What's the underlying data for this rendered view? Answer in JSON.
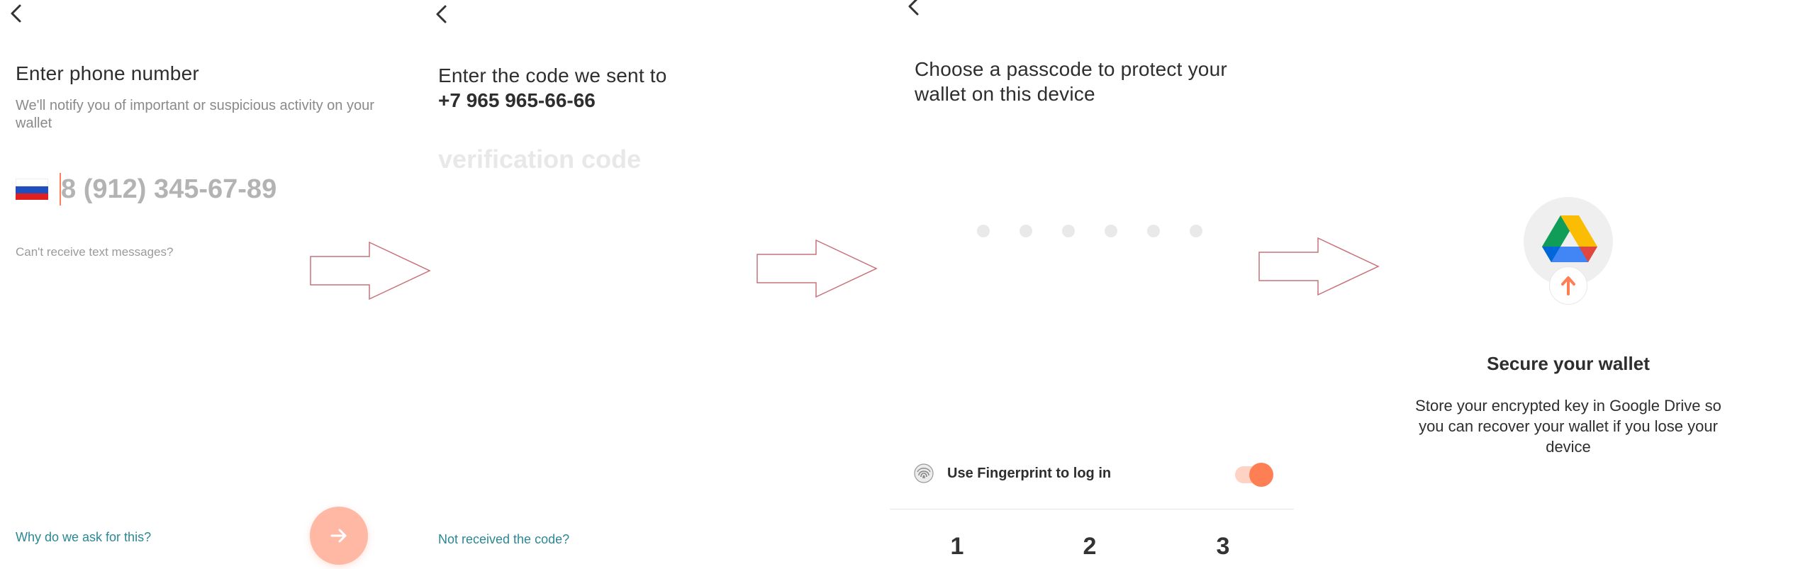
{
  "phone_screen": {
    "title": "Enter phone number",
    "subtitle": "We'll notify you of important or suspicious activity on your wallet",
    "phone_placeholder": "8 (912) 345-67-89",
    "cant_receive": "Can't receive text messages?",
    "why_link": "Why do we ask for this?"
  },
  "code_screen": {
    "title": "Enter the code we sent to",
    "phone": "+7 965 965-66-66",
    "code_placeholder": "verification code",
    "not_received": "Not received the code?"
  },
  "passcode_screen": {
    "title": "Choose a passcode to protect your wallet on this device",
    "dots_count": 6,
    "fingerprint_label": "Use Fingerprint to log in",
    "fingerprint_enabled": true,
    "keys": [
      "1",
      "2",
      "3"
    ]
  },
  "backup_screen": {
    "title": "Secure your wallet",
    "description": "Store your encrypted key in Google Drive so you can recover your wallet if you lose your device"
  },
  "colors": {
    "accent": "#ff7f55",
    "accent_light": "#ffb8a3",
    "link": "#2b8794",
    "arrow_outline": "#c9707a"
  }
}
